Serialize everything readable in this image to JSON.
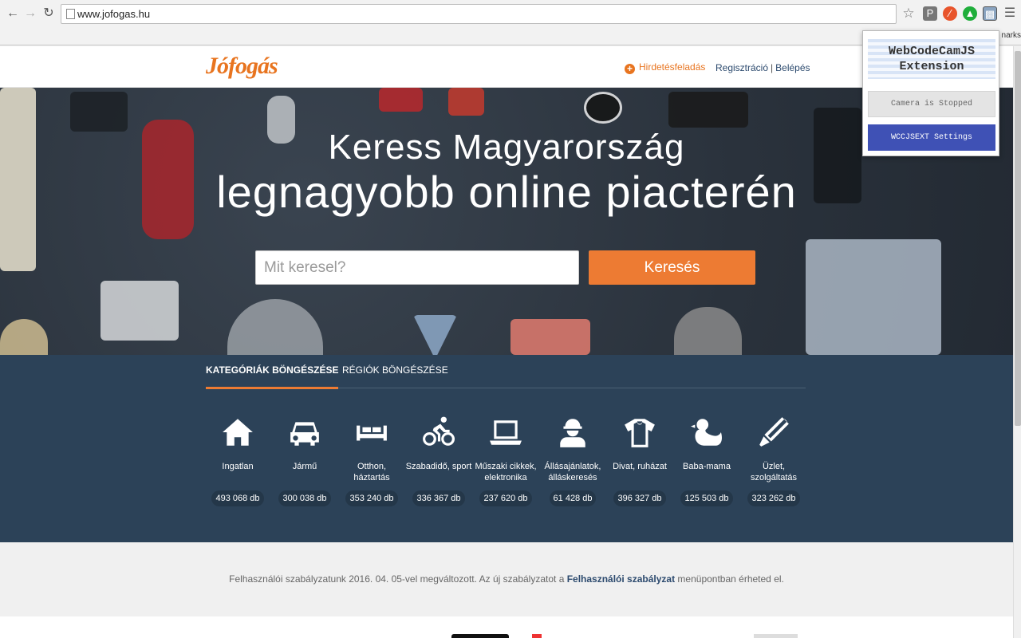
{
  "browser": {
    "url": "www.jofogas.hu",
    "bookmarks_tail": "narks"
  },
  "header": {
    "logo": "Jófogás",
    "post_ad": "Hirdetésfeladás",
    "register": "Regisztráció",
    "separator": "|",
    "login": "Belépés"
  },
  "hero": {
    "title_line1": "Keress Magyarország",
    "title_line2": "legnagyobb online piacterén",
    "search_placeholder": "Mit keresel?",
    "search_button": "Keresés"
  },
  "browse": {
    "tabs": [
      {
        "label": "KATEGÓRIÁK BÖNGÉSZÉSE",
        "active": true
      },
      {
        "label": "RÉGIÓK BÖNGÉSZÉSE",
        "active": false
      }
    ],
    "categories": [
      {
        "label": "Ingatlan",
        "count": "493 068 db",
        "icon": "house-icon"
      },
      {
        "label": "Jármű",
        "count": "300 038 db",
        "icon": "car-icon"
      },
      {
        "label": "Otthon, háztartás",
        "count": "353 240 db",
        "icon": "sofa-icon"
      },
      {
        "label": "Szabadidő, sport",
        "count": "336 367 db",
        "icon": "bicycle-icon"
      },
      {
        "label": "Műszaki cikkek, elektronika",
        "count": "237 620 db",
        "icon": "laptop-icon"
      },
      {
        "label": "Állásajánlatok, álláskeresés",
        "count": "61 428 db",
        "icon": "worker-icon"
      },
      {
        "label": "Divat, ruházat",
        "count": "396 327 db",
        "icon": "tshirt-icon"
      },
      {
        "label": "Baba-mama",
        "count": "125 503 db",
        "icon": "duck-icon"
      },
      {
        "label": "Üzlet, szolgáltatás",
        "count": "323 262 db",
        "icon": "pen-icon"
      }
    ]
  },
  "notice": {
    "prefix": "Felhasználói szabályzatunk 2016. 04. 05-vel megváltozott. Az új szabályzatot a ",
    "link": "Felhasználói szabályzat",
    "suffix": " menüpontban érheted el."
  },
  "extension": {
    "title_line1": "WebCodeCamJS",
    "title_line2": "Extension",
    "status": "Camera is Stopped",
    "settings_button": "WCCJSEXT Settings"
  },
  "colors": {
    "brand_orange": "#ed7b33",
    "navy": "#2c4258",
    "extension_blue": "#3f51b5"
  }
}
